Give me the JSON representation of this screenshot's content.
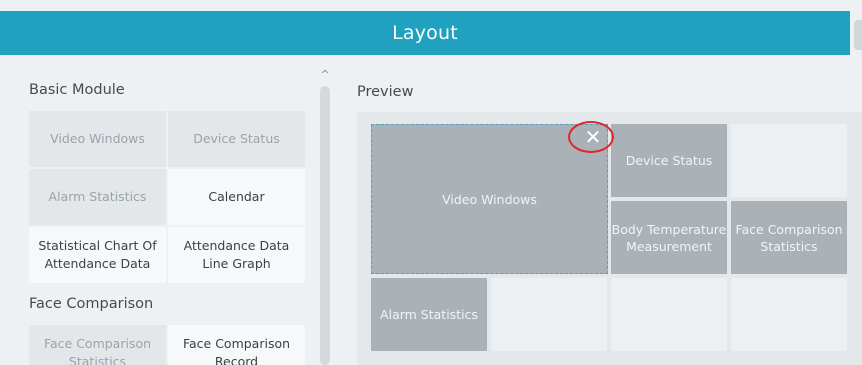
{
  "dialog": {
    "title": "Layout"
  },
  "left_panel": {
    "basic_module": {
      "title": "Basic Module",
      "items": [
        {
          "label": "Video Windows",
          "state": "used"
        },
        {
          "label": "Device Status",
          "state": "used"
        },
        {
          "label": "Alarm Statistics",
          "state": "used"
        },
        {
          "label": "Calendar",
          "state": "free"
        },
        {
          "label": "Statistical Chart Of Attendance Data",
          "state": "free"
        },
        {
          "label": "Attendance Data Line Graph",
          "state": "free"
        }
      ]
    },
    "face_comparison": {
      "title": "Face Comparison",
      "items": [
        {
          "label": "Face Comparison Statistics",
          "state": "used"
        },
        {
          "label": "Face Comparison Record",
          "state": "free"
        }
      ]
    }
  },
  "preview": {
    "title": "Preview",
    "cells": {
      "video_windows": "Video Windows",
      "device_status": "Device Status",
      "body_temperature": "Body Temperature Measurement",
      "face_comparison_statistics": "Face Comparison Statistics",
      "alarm_statistics": "Alarm Statistics"
    },
    "close_glyph": "✕"
  },
  "scroll_glyph": "^"
}
